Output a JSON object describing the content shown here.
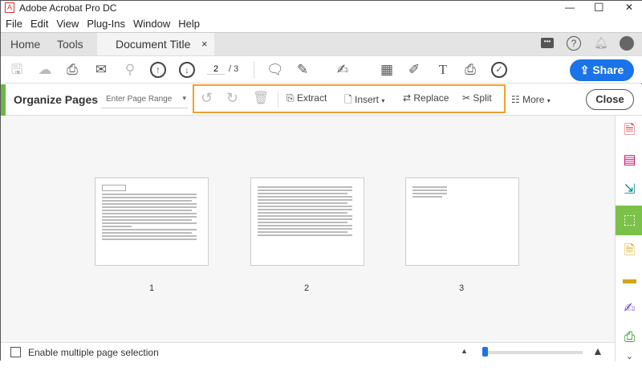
{
  "window": {
    "title": "Adobe Acrobat Pro DC",
    "minimize": "—",
    "maximize": "☐",
    "close": "✕"
  },
  "menu": [
    "File",
    "Edit",
    "View",
    "Plug-Ins",
    "Window",
    "Help"
  ],
  "tabs": {
    "home": "Home",
    "tools": "Tools",
    "document": "Document Title",
    "close": "×"
  },
  "toolbar": {
    "page_current": "2",
    "page_total": "/ 3",
    "share": "Share"
  },
  "organize": {
    "title": "Organize Pages",
    "range_placeholder": "Enter Page Range",
    "extract": "Extract",
    "insert": "Insert",
    "replace": "Replace",
    "split": "Split",
    "more": "More",
    "close": "Close"
  },
  "pages": [
    {
      "label": "1"
    },
    {
      "label": "2"
    },
    {
      "label": "3"
    }
  ],
  "bottom": {
    "multi_select": "Enable multiple page selection"
  },
  "colors": {
    "accent": "#1a73e8",
    "organize": "#6ab84a",
    "highlight": "#f0a030"
  }
}
